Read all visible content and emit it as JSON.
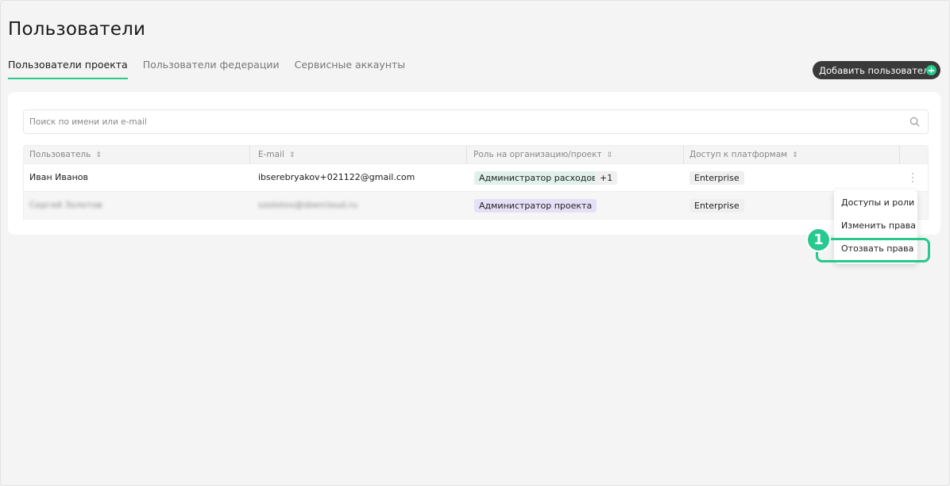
{
  "page": {
    "title": "Пользователи"
  },
  "tabs": [
    {
      "label": "Пользователи проекта",
      "active": true
    },
    {
      "label": "Пользователи федерации",
      "active": false
    },
    {
      "label": "Сервисные аккаунты",
      "active": false
    }
  ],
  "add_button": {
    "label": "Добавить пользователя",
    "icon": "plus-circle-icon"
  },
  "search": {
    "placeholder": "Поиск по имени или e-mail",
    "value": "",
    "icon": "search-icon"
  },
  "table": {
    "columns": [
      "Пользователь",
      "E-mail",
      "Роль на организацию/проект",
      "Доступ к платформам"
    ],
    "sort_icon": "sort-icon",
    "rows": [
      {
        "user": "Иван Иванов",
        "email": "ibserebryakov+021122@gmail.com",
        "role": "Администратор расходов",
        "role_extra": "+1",
        "platform": "Enterprise",
        "blurred": false
      },
      {
        "user": "Сергей Золотов",
        "email": "szolotov@sbercloud.ru",
        "role": "Администратор проекта",
        "role_extra": "",
        "platform": "Enterprise",
        "blurred": true
      }
    ]
  },
  "context_menu": {
    "items": [
      "Доступы и роли",
      "Изменить права",
      "Отозвать права"
    ]
  },
  "callout": {
    "number": "1"
  },
  "colors": {
    "accent": "#27c98f",
    "button_dark": "#3a3a3a",
    "tag_green": "#dff1ea",
    "tag_purple": "#e6e0f7"
  }
}
